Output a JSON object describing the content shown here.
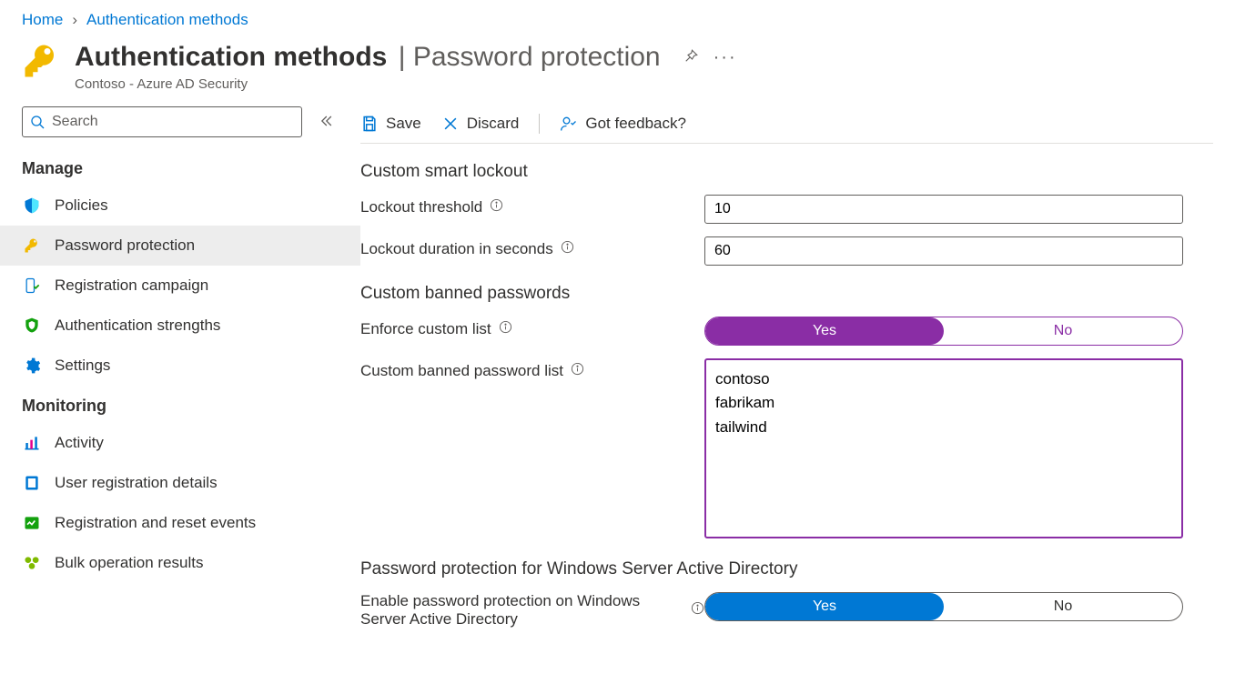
{
  "breadcrumb": {
    "home": "Home",
    "auth_methods": "Authentication methods"
  },
  "header": {
    "title_bold": "Authentication methods",
    "title_light": "| Password protection",
    "subtitle": "Contoso - Azure AD Security"
  },
  "sidebar": {
    "search_placeholder": "Search",
    "section_manage": "Manage",
    "section_monitoring": "Monitoring",
    "items_manage": [
      {
        "label": "Policies"
      },
      {
        "label": "Password protection"
      },
      {
        "label": "Registration campaign"
      },
      {
        "label": "Authentication strengths"
      },
      {
        "label": "Settings"
      }
    ],
    "items_monitoring": [
      {
        "label": "Activity"
      },
      {
        "label": "User registration details"
      },
      {
        "label": "Registration and reset events"
      },
      {
        "label": "Bulk operation results"
      }
    ]
  },
  "toolbar": {
    "save": "Save",
    "discard": "Discard",
    "feedback": "Got feedback?"
  },
  "form": {
    "section_lockout": "Custom smart lockout",
    "lockout_threshold_label": "Lockout threshold",
    "lockout_threshold_value": "10",
    "lockout_duration_label": "Lockout duration in seconds",
    "lockout_duration_value": "60",
    "section_banned": "Custom banned passwords",
    "enforce_label": "Enforce custom list",
    "toggle_yes": "Yes",
    "toggle_no": "No",
    "banned_list_label": "Custom banned password list",
    "banned_list_value": "contoso\nfabrikam\ntailwind",
    "section_winad": "Password protection for Windows Server Active Directory",
    "winad_enable_label": "Enable password protection on Windows Server Active Directory"
  }
}
